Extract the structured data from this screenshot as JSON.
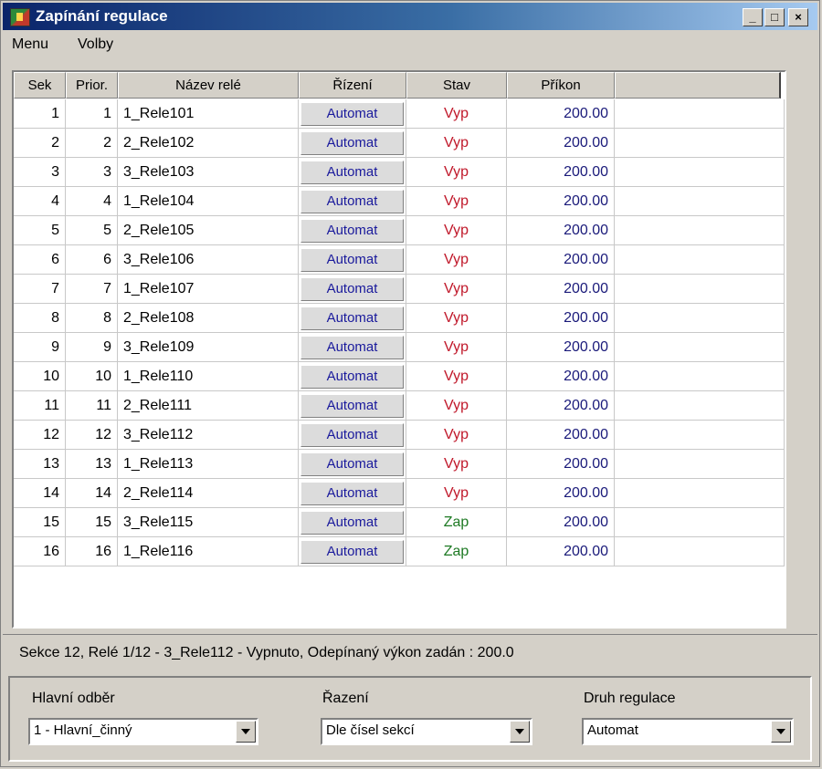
{
  "window": {
    "title": "Zapínání regulace",
    "minimize": "_",
    "maximize": "□",
    "close": "×"
  },
  "menu": {
    "items": [
      "Menu",
      "Volby"
    ]
  },
  "table": {
    "headers": [
      "Sek",
      "Prior.",
      "Název relé",
      "Řízení",
      "Stav",
      "Příkon",
      ""
    ],
    "rows": [
      {
        "sek": "1",
        "prior": "1",
        "name": "1_Rele101",
        "rizeni": "Automat",
        "stav": "Vyp",
        "prikon": "200.00"
      },
      {
        "sek": "2",
        "prior": "2",
        "name": "2_Rele102",
        "rizeni": "Automat",
        "stav": "Vyp",
        "prikon": "200.00"
      },
      {
        "sek": "3",
        "prior": "3",
        "name": "3_Rele103",
        "rizeni": "Automat",
        "stav": "Vyp",
        "prikon": "200.00"
      },
      {
        "sek": "4",
        "prior": "4",
        "name": "1_Rele104",
        "rizeni": "Automat",
        "stav": "Vyp",
        "prikon": "200.00"
      },
      {
        "sek": "5",
        "prior": "5",
        "name": "2_Rele105",
        "rizeni": "Automat",
        "stav": "Vyp",
        "prikon": "200.00"
      },
      {
        "sek": "6",
        "prior": "6",
        "name": "3_Rele106",
        "rizeni": "Automat",
        "stav": "Vyp",
        "prikon": "200.00"
      },
      {
        "sek": "7",
        "prior": "7",
        "name": "1_Rele107",
        "rizeni": "Automat",
        "stav": "Vyp",
        "prikon": "200.00"
      },
      {
        "sek": "8",
        "prior": "8",
        "name": "2_Rele108",
        "rizeni": "Automat",
        "stav": "Vyp",
        "prikon": "200.00"
      },
      {
        "sek": "9",
        "prior": "9",
        "name": "3_Rele109",
        "rizeni": "Automat",
        "stav": "Vyp",
        "prikon": "200.00"
      },
      {
        "sek": "10",
        "prior": "10",
        "name": "1_Rele110",
        "rizeni": "Automat",
        "stav": "Vyp",
        "prikon": "200.00"
      },
      {
        "sek": "11",
        "prior": "11",
        "name": "2_Rele111",
        "rizeni": "Automat",
        "stav": "Vyp",
        "prikon": "200.00"
      },
      {
        "sek": "12",
        "prior": "12",
        "name": "3_Rele112",
        "rizeni": "Automat",
        "stav": "Vyp",
        "prikon": "200.00"
      },
      {
        "sek": "13",
        "prior": "13",
        "name": "1_Rele113",
        "rizeni": "Automat",
        "stav": "Vyp",
        "prikon": "200.00"
      },
      {
        "sek": "14",
        "prior": "14",
        "name": "2_Rele114",
        "rizeni": "Automat",
        "stav": "Vyp",
        "prikon": "200.00"
      },
      {
        "sek": "15",
        "prior": "15",
        "name": "3_Rele115",
        "rizeni": "Automat",
        "stav": "Zap",
        "prikon": "200.00"
      },
      {
        "sek": "16",
        "prior": "16",
        "name": "1_Rele116",
        "rizeni": "Automat",
        "stav": "Zap",
        "prikon": "200.00"
      }
    ]
  },
  "status": {
    "text": "Sekce 12, Relé 1/12 - 3_Rele112 - Vypnuto, Odepínaný výkon zadán : 200.0"
  },
  "controls": {
    "hlavni_odber": {
      "label": "Hlavní odběr",
      "value": "1 - Hlavní_činný"
    },
    "razeni": {
      "label": "Řazení",
      "value": "Dle čísel sekcí"
    },
    "druh_regulace": {
      "label": "Druh regulace",
      "value": "Automat"
    }
  },
  "colors": {
    "vyp": "#c0182a",
    "zap": "#1e7a24",
    "automat_text": "#1a1a9c",
    "titlebar": "#0a246a"
  }
}
